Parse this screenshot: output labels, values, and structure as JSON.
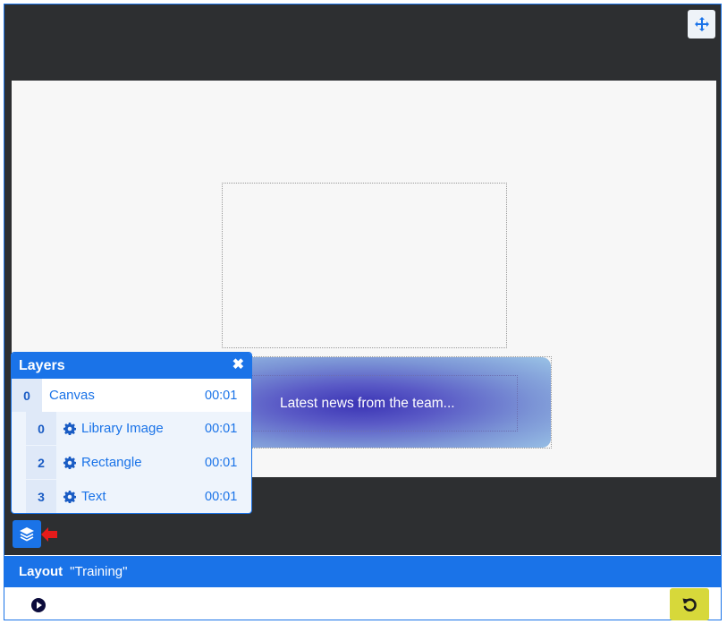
{
  "toolbar": {
    "move_icon": "arrows-move-icon"
  },
  "stage": {
    "text_element": "Latest news from the team..."
  },
  "layers_panel": {
    "title": "Layers",
    "close_icon": "close-icon",
    "rows": [
      {
        "index": "0",
        "name": "Canvas",
        "time": "00:01"
      },
      {
        "index": "0",
        "name": "Library Image",
        "time": "00:01",
        "icon": "gear-icon"
      },
      {
        "index": "2",
        "name": "Rectangle",
        "time": "00:01",
        "icon": "gear-icon"
      },
      {
        "index": "3",
        "name": "Text",
        "time": "00:01",
        "icon": "gear-icon"
      }
    ]
  },
  "layers_toggle_icon": "layers-icon",
  "layout_bar": {
    "label": "Layout",
    "name": "\"Training\""
  },
  "footer": {
    "play_icon": "play-icon",
    "reset_icon": "undo-icon",
    "reset_color": "#d7d83a"
  },
  "colors": {
    "accent": "#1a73e8",
    "dark_bg": "#2d2f31",
    "stage_bg": "#f7f7f7"
  }
}
